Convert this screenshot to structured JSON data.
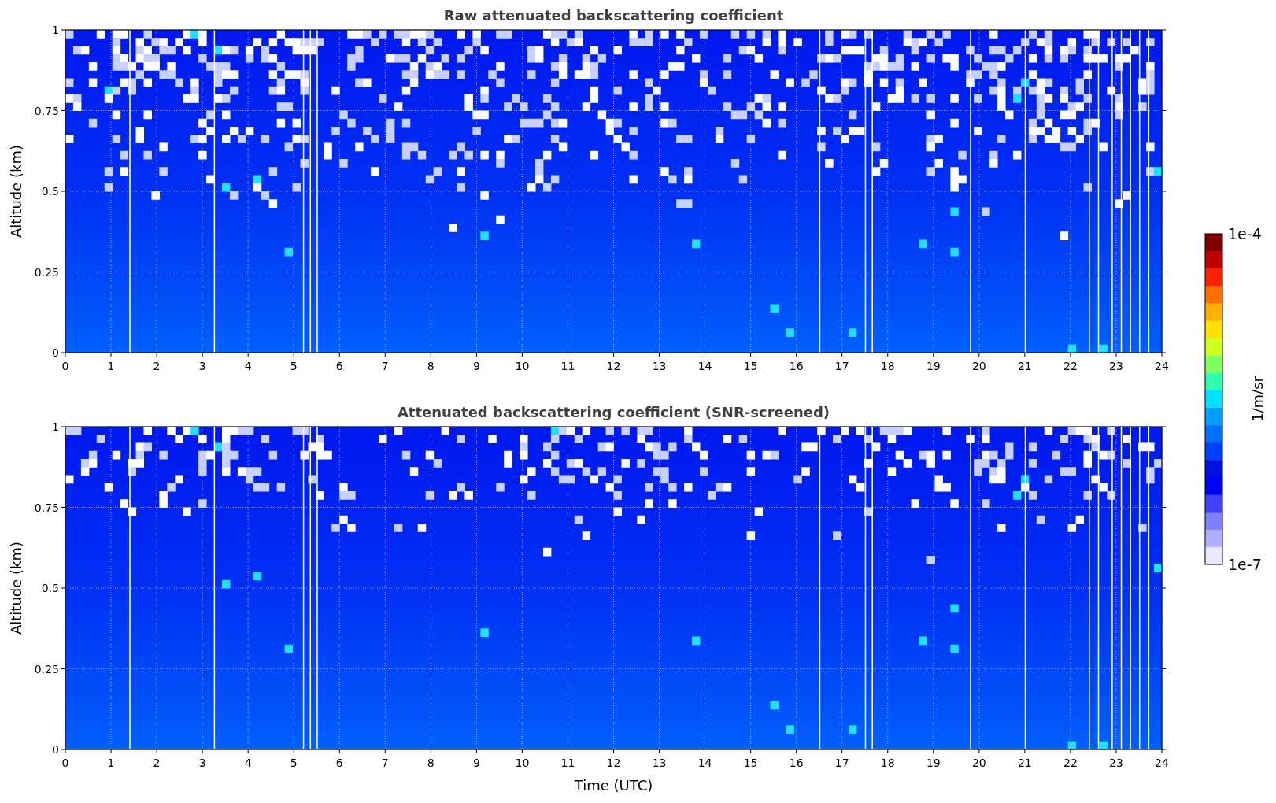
{
  "panels": [
    {
      "title": "Raw attenuated backscattering coefficient",
      "kind": "raw",
      "ylabel": "Altitude (km)",
      "yticks": [
        "1",
        "0.75",
        "0.5",
        "0.25",
        "0"
      ],
      "xticks": [
        "0",
        "1",
        "2",
        "3",
        "4",
        "5",
        "6",
        "7",
        "8",
        "9",
        "10",
        "11",
        "12",
        "13",
        "14",
        "15",
        "16",
        "17",
        "18",
        "19",
        "20",
        "21",
        "22",
        "23",
        "24"
      ]
    },
    {
      "title": "Attenuated backscattering coefficient (SNR-screened)",
      "kind": "screened",
      "ylabel": "Altitude (km)",
      "yticks": [
        "1",
        "0.75",
        "0.5",
        "0.25",
        "0"
      ],
      "xticks": [
        "0",
        "1",
        "2",
        "3",
        "4",
        "5",
        "6",
        "7",
        "8",
        "9",
        "10",
        "11",
        "12",
        "13",
        "14",
        "15",
        "16",
        "17",
        "18",
        "19",
        "20",
        "21",
        "22",
        "23",
        "24"
      ]
    }
  ],
  "xlabel": "Time (UTC)",
  "colorbar": {
    "max": "1e-4",
    "min": "1e-7",
    "label": "1/m/sr"
  }
}
